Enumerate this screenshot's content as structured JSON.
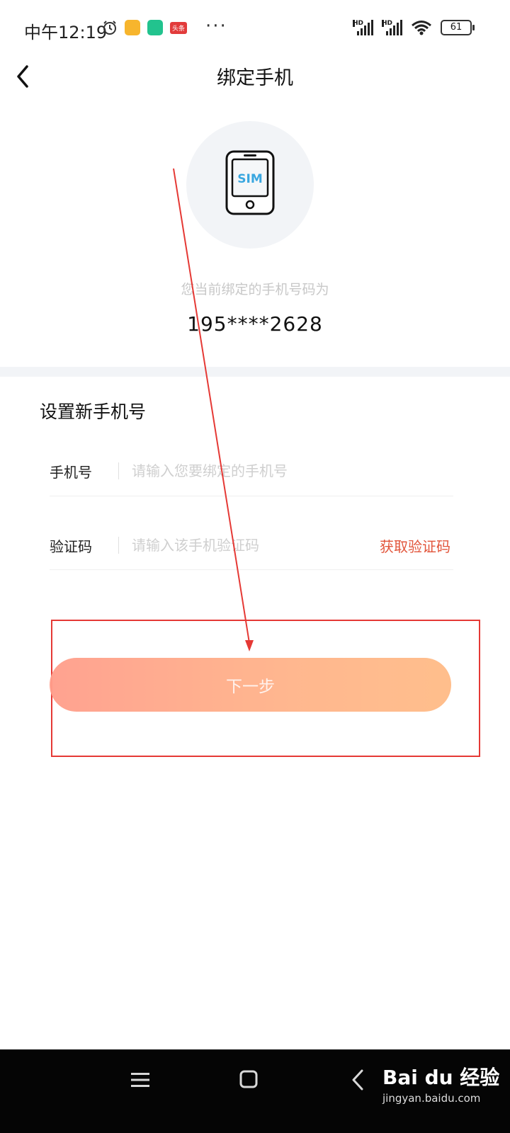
{
  "status_bar": {
    "time": "中午12:19",
    "app_badge": "头条",
    "more": "···",
    "hd1": "HD",
    "hd2": "HD",
    "battery": "61"
  },
  "header": {
    "title": "绑定手机"
  },
  "current": {
    "hint": "您当前绑定的手机号码为",
    "number": "195****2628",
    "sim_text": "SIM"
  },
  "form": {
    "section_title": "设置新手机号",
    "phone": {
      "label": "手机号",
      "placeholder": "请输入您要绑定的手机号",
      "value": ""
    },
    "code": {
      "label": "验证码",
      "placeholder": "请输入该手机验证码",
      "value": "",
      "get_code": "获取验证码"
    },
    "next_button": "下一步"
  },
  "watermark": {
    "brand": "Bai du 经验",
    "sub": "jingyan.baidu.com"
  },
  "colors": {
    "accent": "#e2553b",
    "button_start": "#ff9d8a",
    "button_end": "#ffbb86",
    "annotation": "#e53935"
  },
  "icons": [
    "back-arrow-icon",
    "sim-phone-icon",
    "menu-icon",
    "home-icon",
    "nav-back-icon",
    "alarm-icon",
    "wifi-icon"
  ]
}
